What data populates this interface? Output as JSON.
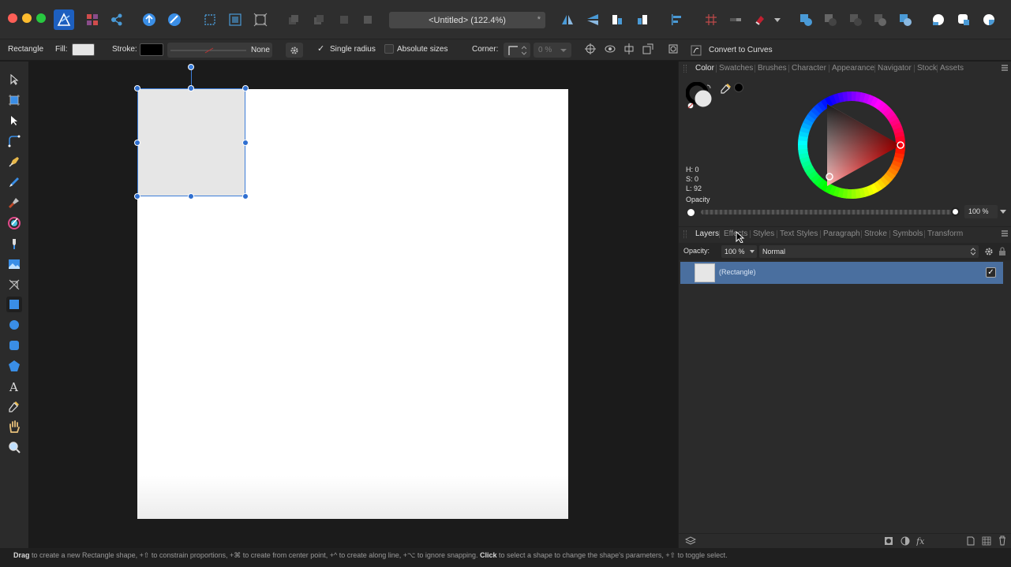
{
  "app": {
    "name": "Affinity Designer",
    "accent": "#2f6fd0"
  },
  "document": {
    "title": "<Untitled> (122.4%)",
    "unsaved_mark": "*"
  },
  "context_toolbar": {
    "tool_name": "Rectangle",
    "fill_label": "Fill:",
    "fill_color": "#e6e6e6",
    "stroke_label": "Stroke:",
    "stroke_color": "#000000",
    "stroke_style_value": "None",
    "single_radius_label": "Single radius",
    "single_radius_checked": true,
    "absolute_sizes_label": "Absolute sizes",
    "absolute_sizes_checked": false,
    "corner_label": "Corner:",
    "corner_value": "0 %",
    "convert_label": "Convert to Curves"
  },
  "color_panel": {
    "tabs": [
      "Color",
      "Swatches",
      "Brushes",
      "Character",
      "Appearance",
      "Navigator",
      "Stock",
      "Assets"
    ],
    "active_tab": "Color",
    "h_label": "H: 0",
    "s_label": "S: 0",
    "l_label": "L: 92",
    "opacity_label": "Opacity",
    "opacity_value": "100 %"
  },
  "layers_panel": {
    "tabs": [
      "Layers",
      "Effects",
      "Styles",
      "Text Styles",
      "Paragraph",
      "Stroke",
      "Symbols",
      "Transform"
    ],
    "active_tab": "Layers",
    "opacity_label": "Opacity:",
    "opacity_value": "100 %",
    "blend_mode": "Normal",
    "layers": [
      {
        "name": "(Rectangle)",
        "visible": true,
        "selected": true
      }
    ]
  },
  "status_bar": {
    "drag_word": "Drag",
    "drag_text": " to create a new Rectangle shape, +⇧ to constrain proportions, +⌘ to create from center point, +^ to create along line, +⌥ to ignore snapping. ",
    "click_word": "Click",
    "click_text": " to select a shape to change the shape's parameters, +⇧ to toggle select."
  }
}
